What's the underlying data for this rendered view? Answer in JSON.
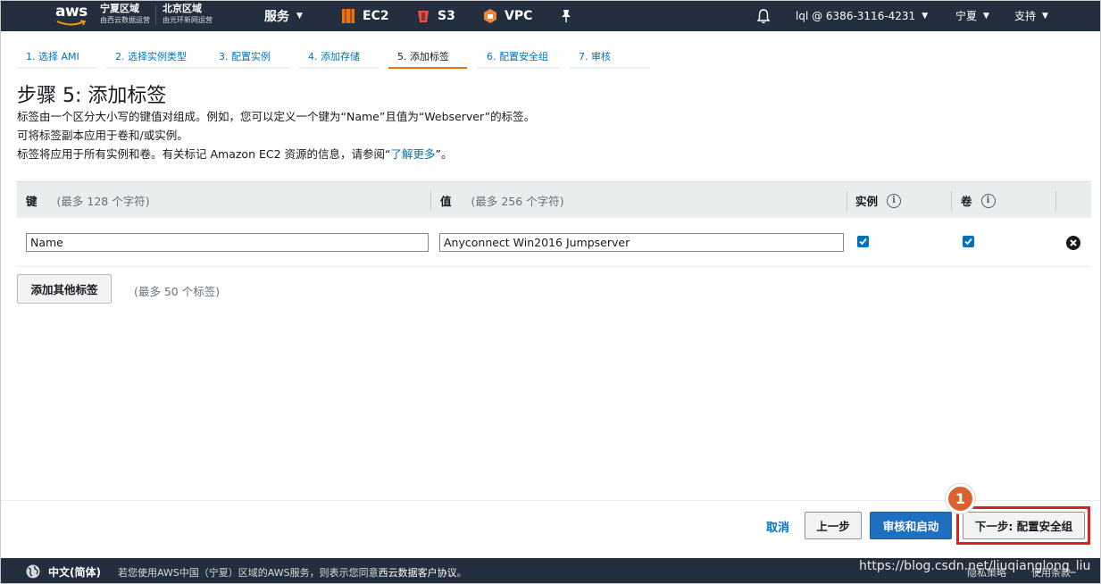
{
  "topnav": {
    "logo": "aws",
    "region1": {
      "title": "宁夏区域",
      "sub": "由西云数据运营"
    },
    "region2": {
      "title": "北京区域",
      "sub": "由光环新网运营"
    },
    "services": "服务",
    "ec2": "EC2",
    "s3": "S3",
    "vpc": "VPC",
    "account": "lql @ 6386-3116-4231",
    "region": "宁夏",
    "support": "支持"
  },
  "steps": [
    "1. 选择 AMI",
    "2. 选择实例类型",
    "3. 配置实例",
    "4. 添加存储",
    "5. 添加标签",
    "6. 配置安全组",
    "7. 审核"
  ],
  "page": {
    "title": "步骤 5: 添加标签",
    "desc1": "标签由一个区分大小写的键值对组成。例如，您可以定义一个键为“Name”且值为“Webserver”的标签。",
    "desc2": "可将标签副本应用于卷和/或实例。",
    "desc3_pre": "标签将应用于所有实例和卷。有关标记 Amazon EC2 资源的信息，请参阅“",
    "desc3_link": "了解更多",
    "desc3_post": "”。"
  },
  "table": {
    "col_key": "键",
    "col_key_hint": "(最多 128 个字符)",
    "col_value": "值",
    "col_value_hint": "(最多 256 个字符)",
    "col_instance": "实例",
    "col_volume": "卷",
    "info": "i",
    "rows": [
      {
        "key": "Name",
        "value": "Anyconnect Win2016 Jumpserver",
        "instance": true,
        "volume": true
      }
    ]
  },
  "add_tag": {
    "label": "添加其他标签",
    "hint": "(最多 50 个标签)"
  },
  "actions": {
    "cancel": "取消",
    "previous": "上一步",
    "review": "审核和启动",
    "next": "下一步: 配置安全组",
    "badge": "1"
  },
  "footer": {
    "language": "中文(简体)",
    "legal_pre": "若您使用AWS中国（宁夏）区域的AWS服务，则表示您同意",
    "legal_bold": "西云数据客户协议",
    "legal_post": "。",
    "privacy": "隐私策略",
    "terms": "使用条款"
  },
  "watermark": "https://blog.csdn.net/liuqianglong_liu",
  "colors": {
    "nav_bg": "#232f3e",
    "accent": "#ec7211",
    "link": "#0073bb",
    "primary": "#1f6fbf",
    "highlight": "#e02020"
  }
}
